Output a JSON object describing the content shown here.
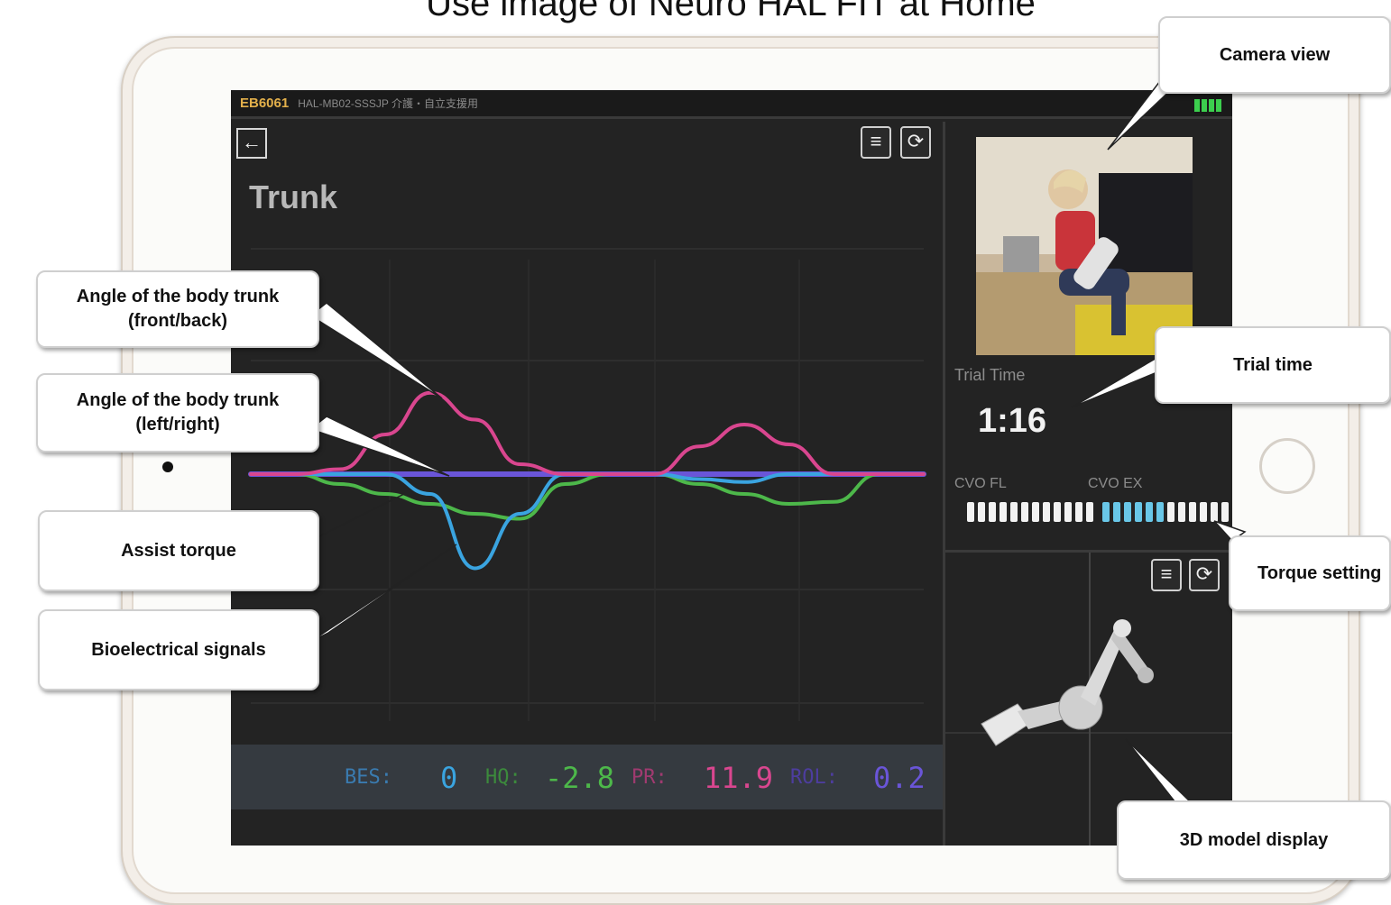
{
  "page_title": "Use image of Neuro HAL FIT at Home",
  "status_bar": {
    "device_id": "EB6061",
    "device_info": "HAL-MB02-SSSJP 介護・自立支援用"
  },
  "main_panel": {
    "title": "Trunk",
    "back_icon": "arrow-left-icon",
    "menu_icon": "menu-icon",
    "rotate_icon": "rotate-icon"
  },
  "readout": {
    "bes_label": "BES:",
    "bes_value": "0",
    "hq_label": "HQ:",
    "hq_value": "-2.8",
    "pr_label": "PR:",
    "pr_value": "11.9",
    "rol_label": "ROL:",
    "rol_value": "0.2"
  },
  "side_panel": {
    "trial_time_label": "Trial Time",
    "trial_time_value": "1:16",
    "cvo_fl_label": "CVO FL",
    "cvo_ex_label": "CVO EX"
  },
  "callouts": {
    "angle_front_back": "Angle of the body trunk (front/back)",
    "angle_left_right": "Angle of the body trunk (left/right)",
    "assist_torque": "Assist torque",
    "bioelectrical": "Bioelectrical signals",
    "camera_view": "Camera view",
    "trial_time": "Trial time",
    "torque_setting": "Torque setting",
    "model_display": "3D model display"
  },
  "colors": {
    "pink": "#d9468f",
    "blue": "#3aa4e0",
    "green": "#4db84a",
    "purple": "#6a55d8",
    "screen_bg": "#232323"
  },
  "chart_data": {
    "type": "line",
    "title": "",
    "xlabel": "",
    "ylabel": "",
    "grid": true,
    "series": [
      {
        "values": [
          0,
          0,
          5,
          40,
          82,
          55,
          10,
          0,
          0,
          0,
          28,
          50,
          30,
          0,
          0,
          0
        ]
      },
      {
        "values": [
          0,
          0,
          0,
          0,
          -20,
          -95,
          -40,
          0,
          0,
          0,
          -5,
          -8,
          0,
          0,
          0,
          0
        ]
      },
      {
        "values": [
          0,
          0,
          -10,
          -20,
          -30,
          -40,
          -45,
          -10,
          0,
          0,
          -10,
          -20,
          -30,
          -28,
          0,
          0
        ]
      },
      {
        "values": [
          0,
          0,
          0,
          0,
          0,
          0,
          0,
          0,
          0,
          0,
          0,
          0,
          0,
          0,
          0,
          0
        ]
      }
    ]
  }
}
